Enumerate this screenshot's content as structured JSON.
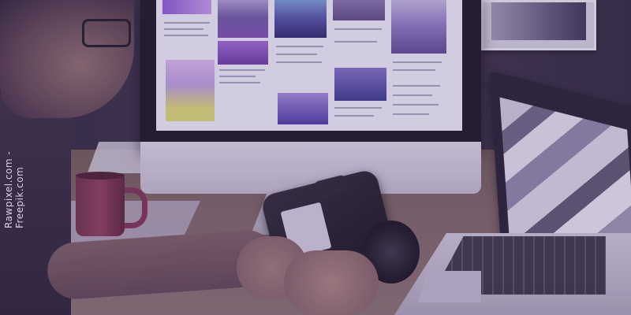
{
  "watermark": {
    "text": "Rawpixel.com - Freepik.com"
  },
  "palette": {
    "tint": "#6a3c8c",
    "shadow": "#2b2436"
  }
}
